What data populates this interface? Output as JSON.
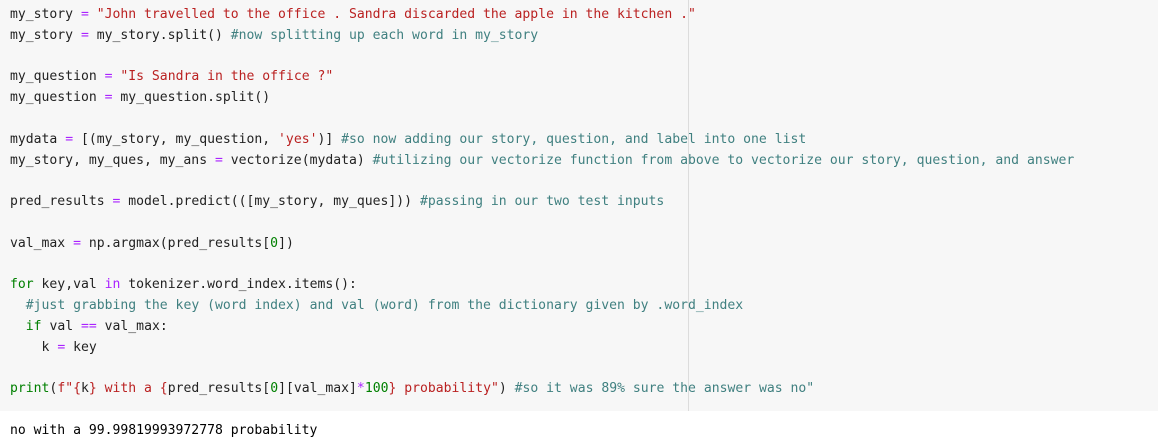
{
  "code_lines": [
    [
      [
        "txt",
        "my_story "
      ],
      [
        "op",
        "="
      ],
      [
        "txt",
        " "
      ],
      [
        "str",
        "\"John travelled to the office . Sandra discarded the apple in the kitchen .\""
      ]
    ],
    [
      [
        "txt",
        "my_story "
      ],
      [
        "op",
        "="
      ],
      [
        "txt",
        " my_story.split() "
      ],
      [
        "cm",
        "#now splitting up each word in my_story"
      ]
    ],
    [],
    [
      [
        "txt",
        "my_question "
      ],
      [
        "op",
        "="
      ],
      [
        "txt",
        " "
      ],
      [
        "str",
        "\"Is Sandra in the office ?\""
      ]
    ],
    [
      [
        "txt",
        "my_question "
      ],
      [
        "op",
        "="
      ],
      [
        "txt",
        " my_question.split()"
      ]
    ],
    [],
    [
      [
        "txt",
        "mydata "
      ],
      [
        "op",
        "="
      ],
      [
        "txt",
        " [(my_story, my_question, "
      ],
      [
        "str",
        "'yes'"
      ],
      [
        "txt",
        ")] "
      ],
      [
        "cm",
        "#so now adding our story, question, and label into one list"
      ]
    ],
    [
      [
        "txt",
        "my_story, my_ques, my_ans "
      ],
      [
        "op",
        "="
      ],
      [
        "txt",
        " vectorize(mydata) "
      ],
      [
        "cm",
        "#utilizing our vectorize function from above to vectorize our story, question, and answer"
      ]
    ],
    [],
    [
      [
        "txt",
        "pred_results "
      ],
      [
        "op",
        "="
      ],
      [
        "txt",
        " model.predict(([my_story, my_ques])) "
      ],
      [
        "cm",
        "#passing in our two test inputs"
      ]
    ],
    [],
    [
      [
        "txt",
        "val_max "
      ],
      [
        "op",
        "="
      ],
      [
        "txt",
        " np.argmax(pred_results["
      ],
      [
        "num",
        "0"
      ],
      [
        "txt",
        "])"
      ]
    ],
    [],
    [
      [
        "kw",
        "for"
      ],
      [
        "txt",
        " key,val "
      ],
      [
        "op",
        "in"
      ],
      [
        "txt",
        " tokenizer.word_index.items():"
      ]
    ],
    [
      [
        "txt",
        "  "
      ],
      [
        "cm",
        "#just grabbing the key (word index) and val (word) from the dictionary given by .word_index"
      ]
    ],
    [
      [
        "txt",
        "  "
      ],
      [
        "kw",
        "if"
      ],
      [
        "txt",
        " val "
      ],
      [
        "op",
        "=="
      ],
      [
        "txt",
        " val_max:"
      ]
    ],
    [
      [
        "txt",
        "    k "
      ],
      [
        "op",
        "="
      ],
      [
        "txt",
        " key"
      ]
    ],
    [],
    [
      [
        "kw",
        "print"
      ],
      [
        "txt",
        "("
      ],
      [
        "str",
        "f\"{"
      ],
      [
        "txt",
        "k"
      ],
      [
        "str",
        "} with a {"
      ],
      [
        "txt",
        "pred_results["
      ],
      [
        "num",
        "0"
      ],
      [
        "txt",
        "][val_max]"
      ],
      [
        "op",
        "*"
      ],
      [
        "num",
        "100"
      ],
      [
        "str",
        "} probability\""
      ],
      [
        "txt",
        ") "
      ],
      [
        "cm",
        "#so it was 89% sure the answer was no\""
      ]
    ]
  ],
  "output": "no with a 99.99819993972778 probability"
}
